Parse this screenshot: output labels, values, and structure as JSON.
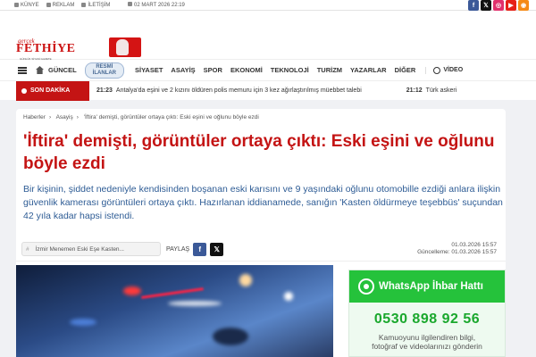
{
  "topbar": {
    "links": [
      "KÜNYE",
      "REKLAM",
      "İLETİŞİM"
    ],
    "date": "02 MART 2026 22:19",
    "social_colors": {
      "facebook": "#3b5998",
      "x": "#111111",
      "instagram": "#e1306c",
      "youtube": "#e62117",
      "rss": "#f58a15"
    }
  },
  "logo": {
    "small": "gerçek",
    "name": "FETHİYE",
    "tagline": "GÜNLÜK SİYASİ GAZETE"
  },
  "nav": {
    "items": [
      "GÜNCEL",
      "SİYASET",
      "ASAYİŞ",
      "SPOR",
      "EKONOMİ",
      "TEKNOLOJİ",
      "TURİZM",
      "YAZARLAR",
      "DİĞER"
    ],
    "resmi_line1": "RESMİ",
    "resmi_line2": "İLANLAR",
    "video": "VİDEO"
  },
  "breaking": {
    "label": "SON DAKİKA",
    "items": [
      {
        "time": "21:23",
        "text": "Antalya'da eşini ve 2 kızını öldüren polis memuru için 3 kez ağırlaştırılmış müebbet talebi"
      },
      {
        "time": "21:12",
        "text": "Türk askeri"
      }
    ]
  },
  "article": {
    "breadcrumb": [
      "Haberler",
      "Asayiş",
      "'İftira' demişti, görüntüler ortaya çıktı: Eski eşini ve oğlunu böyle ezdi"
    ],
    "title": "'İftira' demişti, görüntüler ortaya çıktı: Eski eşini ve oğlunu böyle ezdi",
    "summary": "Bir kişinin, şiddet nedeniyle kendisinden boşanan eski karısını ve 9 yaşındaki oğlunu otomobille ezdiği anlara ilişkin güvenlik kamerası görüntüleri ortaya çıktı. Hazırlanan iddianamede, sanığın 'Kasten öldürmeye teşebbüs' suçundan 42 yıla kadar hapsi istendi.",
    "tag_hash": "#",
    "tag": "İzmir Menemen Eski Eşe Kasten...",
    "share_label": "PAYLAŞ",
    "published": "01.03.2026 15:57",
    "updated_label": "Güncelleme:",
    "updated": "01.03.2026 15:57"
  },
  "whatsapp": {
    "title": "WhatsApp İhbar Hattı",
    "phone": "0530 898 92 56",
    "text_line1": "Kamuoyunu ilgilendiren bilgi,",
    "text_line2": "fotoğraf ve videolarınızı gönderin"
  }
}
